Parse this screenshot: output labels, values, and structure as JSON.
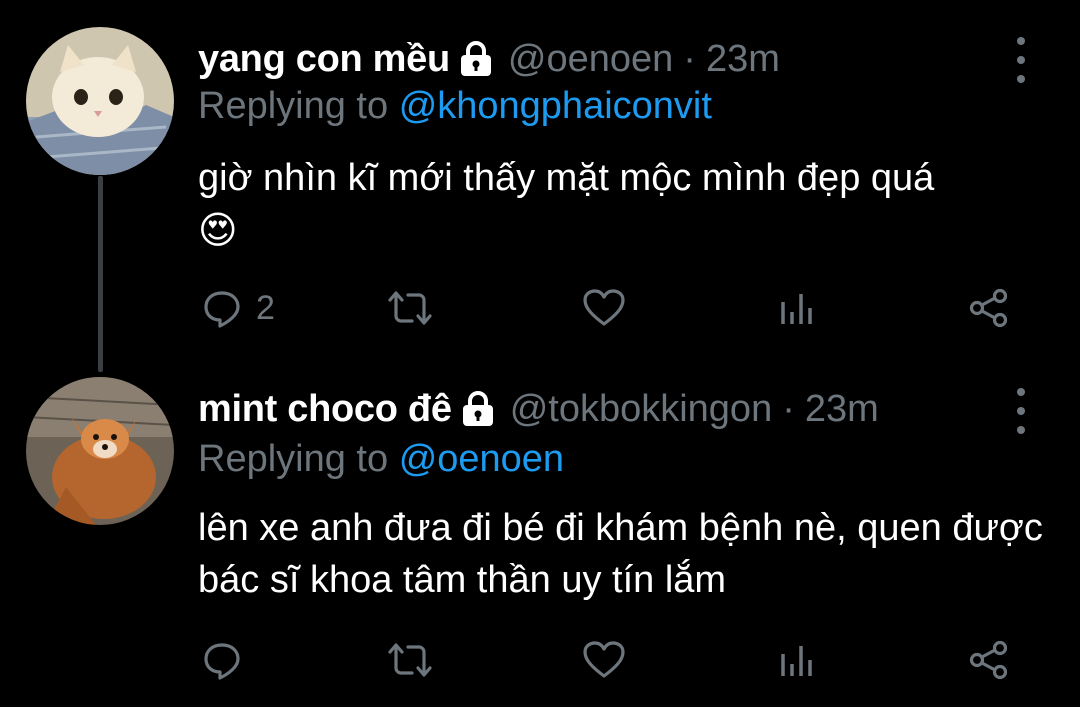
{
  "tweets": [
    {
      "name": "yang con mều",
      "handle": "@oenoen",
      "separator": "·",
      "time": "23m",
      "replying_prefix": "Replying to",
      "replying_to": "@khongphaiconvit",
      "text": "giờ nhìn kĩ mới thấy mặt mộc mình đẹp quá",
      "emoji": "😍",
      "reply_count": "2",
      "avatar": "cat-avatar"
    },
    {
      "name": "mint choco đê",
      "handle": "@tokbokkingon",
      "separator": "·",
      "time": "23m",
      "replying_prefix": "Replying to",
      "replying_to": "@oenoen",
      "text": "lên xe anh đưa đi bé đi khám bệnh nè, quen được bác sĩ khoa tâm thần uy tín lắm",
      "reply_count": "",
      "avatar": "fox-avatar"
    }
  ],
  "colors": {
    "background": "#000000",
    "text": "#ffffff",
    "muted": "#6e767d",
    "link": "#1d9bf0",
    "thread_line": "#3a3f44"
  },
  "icons": [
    "lock-icon",
    "more-icon",
    "reply-icon",
    "retweet-icon",
    "like-icon",
    "analytics-icon",
    "share-icon"
  ]
}
